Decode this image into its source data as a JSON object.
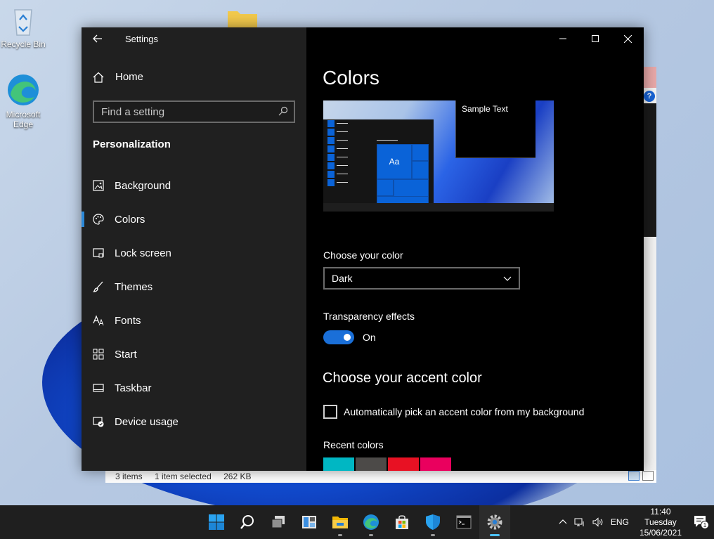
{
  "desktop": {
    "icons": [
      {
        "label": "Recycle Bin"
      },
      {
        "label": "Microsoft Edge"
      }
    ]
  },
  "background_window": {
    "status_items": "3 items",
    "status_selected": "1 item selected",
    "status_size": "262 KB"
  },
  "settings": {
    "title": "Settings",
    "home_label": "Home",
    "search_placeholder": "Find a setting",
    "section_heading": "Personalization",
    "nav_items": [
      {
        "label": "Background",
        "icon": "picture-icon"
      },
      {
        "label": "Colors",
        "icon": "palette-icon",
        "active": true
      },
      {
        "label": "Lock screen",
        "icon": "lock-screen-icon"
      },
      {
        "label": "Themes",
        "icon": "brush-icon"
      },
      {
        "label": "Fonts",
        "icon": "font-icon"
      },
      {
        "label": "Start",
        "icon": "start-grid-icon"
      },
      {
        "label": "Taskbar",
        "icon": "taskbar-icon"
      },
      {
        "label": "Device usage",
        "icon": "device-usage-icon"
      }
    ],
    "page_title": "Colors",
    "preview": {
      "sample_text": "Sample Text",
      "tile_text": "Aa"
    },
    "choose_color_label": "Choose your color",
    "choose_color_value": "Dark",
    "transparency_label": "Transparency effects",
    "transparency_state": "On",
    "accent_title": "Choose your accent color",
    "auto_accent_label": "Automatically pick an accent color from my background",
    "recent_colors_label": "Recent colors",
    "recent_colors": [
      "#00b7c3",
      "#4c4a48",
      "#e81123",
      "#ea005e"
    ]
  },
  "taskbar": {
    "apps": [
      "start-icon",
      "search-icon",
      "task-view-icon",
      "widgets-icon",
      "file-explorer-icon",
      "edge-icon",
      "store-icon",
      "defender-icon",
      "terminal-icon",
      "settings-icon"
    ],
    "language": "ENG",
    "time": "11:40",
    "day": "Tuesday",
    "date": "15/06/2021",
    "notification_count": "1"
  },
  "colors": {
    "accent": "#2b88d8",
    "nav_bg": "#202020",
    "content_bg": "#000000"
  }
}
